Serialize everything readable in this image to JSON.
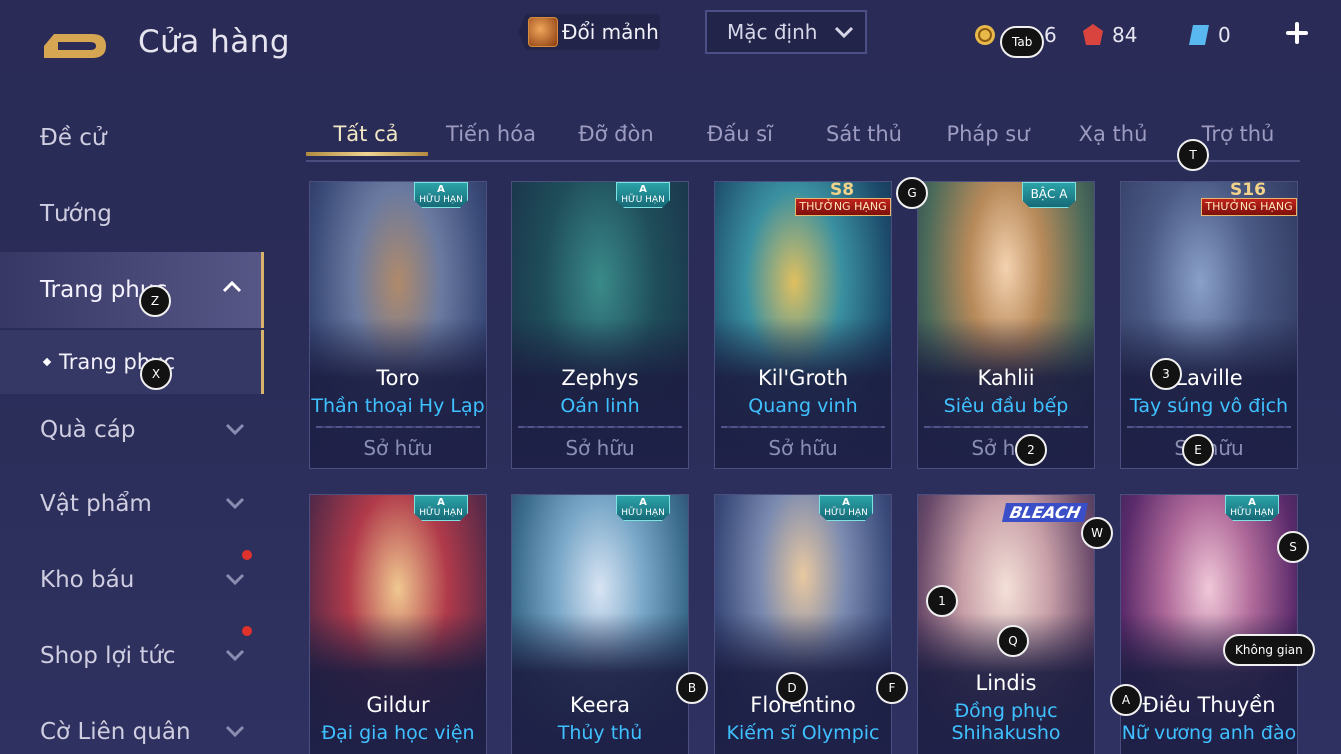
{
  "header": {
    "title": "Cửa hàng",
    "exchange_label": "Đổi mảnh",
    "sort_label": "Mặc định",
    "currencies": [
      {
        "icon": "gold-coin-icon",
        "value": "6"
      },
      {
        "icon": "ruby-icon",
        "value": "84"
      },
      {
        "icon": "voucher-icon",
        "value": "0"
      }
    ]
  },
  "sidebar": {
    "items": [
      {
        "label": "Đề cử"
      },
      {
        "label": "Tướng"
      },
      {
        "label": "Trang phục"
      },
      {
        "label": "Quà cáp"
      },
      {
        "label": "Vật phẩm"
      },
      {
        "label": "Kho báu"
      },
      {
        "label": "Shop lợi tức"
      },
      {
        "label": "Cờ Liên quân"
      }
    ],
    "sub_item": "Trang phục"
  },
  "tabs": [
    "Tất cả",
    "Tiến hóa",
    "Đỡ đòn",
    "Đấu sĩ",
    "Sát thủ",
    "Pháp sư",
    "Xạ thủ",
    "Trợ thủ"
  ],
  "cards_row1": [
    {
      "hero": "Toro",
      "skin": "Thần thoại Hy Lạp",
      "status": "Sở hữu",
      "tag_top": "A",
      "tag_bottom": "HỮU HẠN"
    },
    {
      "hero": "Zephys",
      "skin": "Oán linh",
      "status": "Sở hữu",
      "tag_top": "A",
      "tag_bottom": "HỮU HẠN"
    },
    {
      "hero": "Kil'Groth",
      "skin": "Quang vinh",
      "status": "Sở hữu",
      "rank_num": "S8",
      "rank_label": "THƯỞNG HẠNG"
    },
    {
      "hero": "Kahlii",
      "skin": "Siêu đầu bếp",
      "status": "Sở hữu",
      "tag_label": "BẬC A"
    },
    {
      "hero": "Laville",
      "skin": "Tay súng vô địch",
      "status": "Sở hữu",
      "rank_num": "S16",
      "rank_label": "THƯỞNG HẠNG"
    }
  ],
  "cards_row2": [
    {
      "hero": "Gildur",
      "skin": "Đại gia học viện",
      "tag_top": "A",
      "tag_bottom": "HỮU HẠN"
    },
    {
      "hero": "Keera",
      "skin": "Thủy thủ",
      "tag_top": "A",
      "tag_bottom": "HỮU HẠN"
    },
    {
      "hero": "Florentino",
      "skin": "Kiếm sĩ Olympic",
      "tag_top": "A",
      "tag_bottom": "HỮU HẠN"
    },
    {
      "hero": "Lindis",
      "skin": "Đồng phục Shihakusho",
      "logo_text": "BLEACH"
    },
    {
      "hero": "Điêu Thuyền",
      "skin": "Nữ vương anh đào",
      "tag_top": "A",
      "tag_bottom": "HỮU HẠN"
    }
  ],
  "key_hints": [
    "Tab",
    "Z",
    "X",
    "T",
    "G",
    "3",
    "2",
    "E",
    "W",
    "S",
    "1",
    "Q",
    "B",
    "D",
    "F",
    "A",
    "Không gian"
  ]
}
